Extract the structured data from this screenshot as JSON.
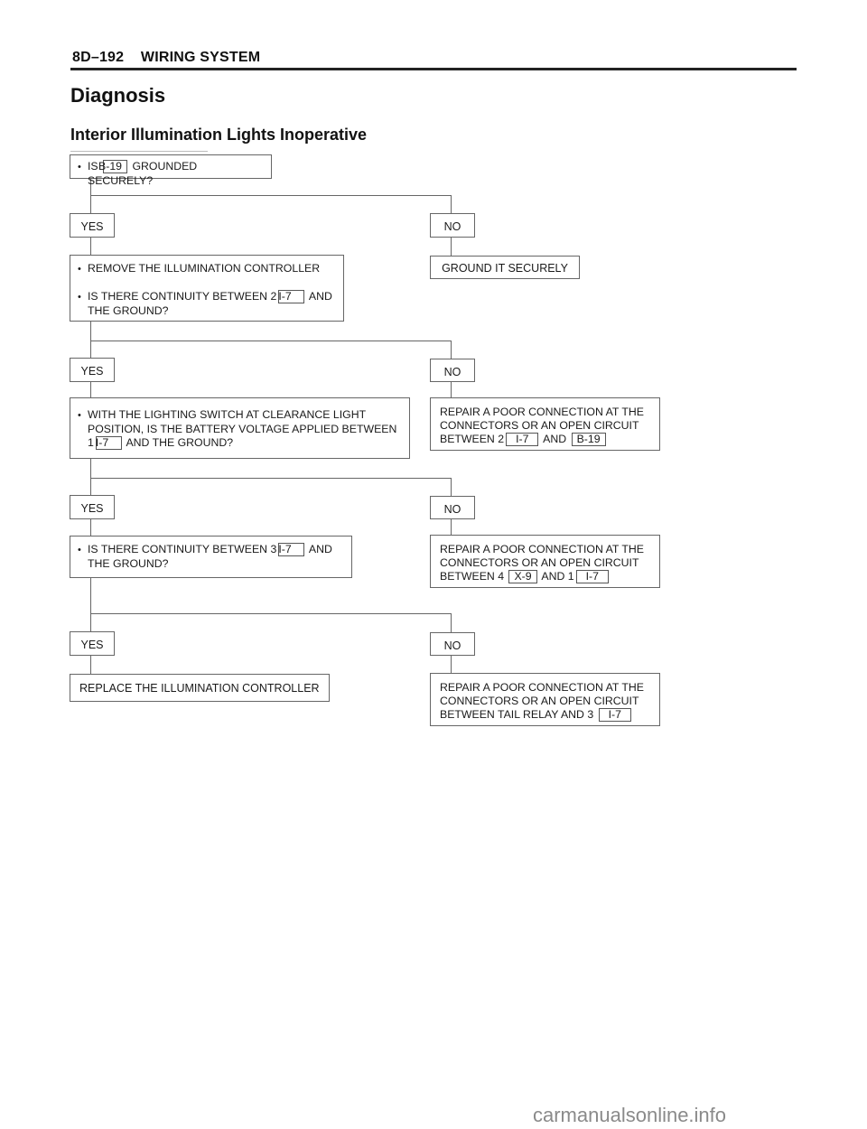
{
  "header": {
    "page_number": "8D–192",
    "section": "WIRING SYSTEM"
  },
  "title": "Diagnosis",
  "subtitle": "Interior Illumination Lights Inoperative",
  "flowchart": {
    "step1": {
      "pre": "IS",
      "connector": "B-19",
      "post": "GROUNDED SECURELY?",
      "yes": "YES",
      "no": "NO",
      "no_action": "GROUND IT SECURELY"
    },
    "step2": {
      "line1": "REMOVE THE ILLUMINATION CONTROLLER",
      "line2_pre": "IS THERE CONTINUITY BETWEEN 2",
      "connector": "I-7",
      "line2_post": "AND",
      "line3": "THE GROUND?",
      "yes": "YES",
      "no": "NO",
      "no_action": {
        "line1": "REPAIR A POOR CONNECTION AT THE",
        "line2": "CONNECTORS OR AN OPEN CIRCUIT",
        "line3_pre": "BETWEEN 2",
        "connector_a": "I-7",
        "mid": "AND",
        "connector_b": "B-19"
      }
    },
    "step3": {
      "line1": "WITH THE LIGHTING SWITCH AT CLEARANCE LIGHT",
      "line2": "POSITION, IS THE BATTERY VOLTAGE APPLIED BETWEEN",
      "line3_pre": "1",
      "connector": "I-7",
      "line3_post": "AND THE GROUND?",
      "yes": "YES",
      "no": "NO",
      "no_action": {
        "line1": "REPAIR A POOR CONNECTION AT THE",
        "line2": "CONNECTORS OR AN OPEN CIRCUIT",
        "line3_pre": "BETWEEN 4",
        "connector_a": "X-9",
        "mid": "AND 1",
        "connector_b": "I-7"
      }
    },
    "step4": {
      "line1_pre": "IS THERE CONTINUITY  BETWEEN 3",
      "connector": "I-7",
      "line1_post": "AND",
      "line2": "THE GROUND?",
      "yes": "YES",
      "no": "NO",
      "yes_action": "REPLACE THE ILLUMINATION CONTROLLER",
      "no_action": {
        "line1": "REPAIR A POOR CONNECTION AT THE",
        "line2": "CONNECTORS OR AN OPEN CIRCUIT",
        "line3_pre": "BETWEEN TAIL RELAY AND 3",
        "connector": "I-7"
      }
    }
  },
  "watermark": "carmanualsonline.info"
}
